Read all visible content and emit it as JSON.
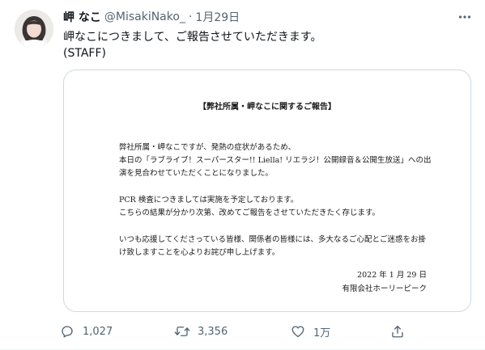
{
  "tweet": {
    "display_name": "岬 なこ",
    "handle": "@MisakiNako_",
    "separator": "·",
    "date": "1月29日",
    "text_lines": [
      "岬なこにつきまして、ご報告させていただきます。",
      "(STAFF)"
    ],
    "icons": {
      "avatar": "avatar",
      "more": "more-icon"
    }
  },
  "notice": {
    "title": "【弊社所属・岬なこに関するご報告】",
    "body_lines": [
      "弊社所属・岬なこですが、発熱の症状があるため、",
      "本日の「ラブライブ！スーパースター!! Liella! リエラジ！公開録音＆公開生放送」への出",
      "演を見合わせていただくことになりました。",
      "",
      "PCR 検査につきましては実施を予定しております。",
      "こちらの結果が分かり次第、改めてご報告をさせていただきたく存じます。",
      "",
      "いつも応援してくださっている皆様、関係者の皆様には、多大なるご心配とご迷惑をお掛",
      "け致しますことを心よりお詫び申し上げます。"
    ],
    "date": "2022 年 1 月 29 日",
    "company": "有限会社ホーリーピーク"
  },
  "actions": {
    "reply_count": "1,027",
    "retweet_count": "3,356",
    "like_count": "1万",
    "icons": {
      "reply": "reply-icon",
      "retweet": "retweet-icon",
      "like": "like-icon",
      "share": "share-icon"
    }
  },
  "colors": {
    "text_primary": "#0f1419",
    "text_secondary": "#536471",
    "card_border": "#cfd9de"
  }
}
